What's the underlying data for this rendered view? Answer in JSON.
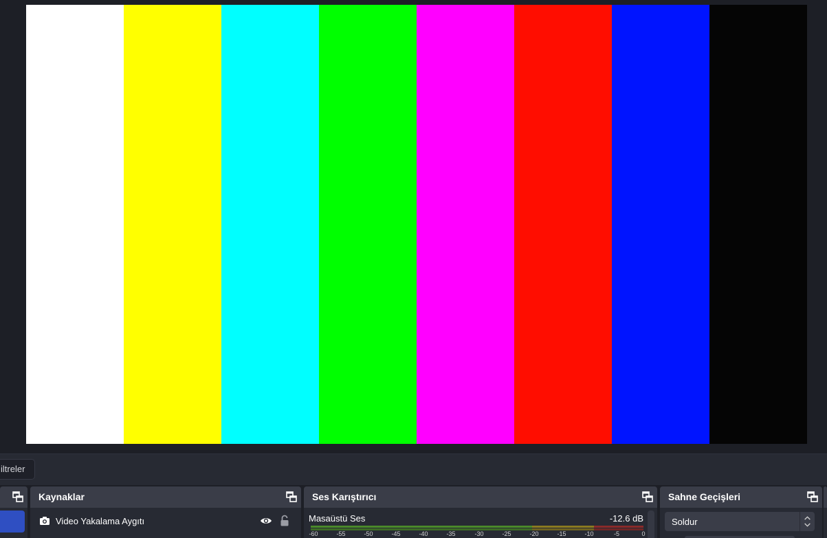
{
  "preview": {
    "color_bars": [
      "#ffffff",
      "#ffff00",
      "#00ffff",
      "#00ff00",
      "#ff00ff",
      "#ff0d00",
      "#0014ff",
      "#050505"
    ]
  },
  "toolbar": {
    "filters_label": "iltreler"
  },
  "docks": {
    "sources": {
      "title": "Kaynaklar",
      "items": [
        {
          "label": "Video Yakalama Aygıtı",
          "icon": "camera-icon"
        }
      ]
    },
    "mixer": {
      "title": "Ses Karıştırıcı",
      "channel": {
        "name": "Masaüstü Ses",
        "level": "-12.6 dB"
      },
      "scale_labels": [
        "-60",
        "-55",
        "-50",
        "-45",
        "-40",
        "-35",
        "-30",
        "-25",
        "-20",
        "-15",
        "-10",
        "-5",
        "0"
      ]
    },
    "transitions": {
      "title": "Sahne Geçişleri",
      "selected": "Soldur"
    }
  },
  "colors": {
    "accent": "#2f4fc2",
    "meter_green": "#4a8a2a",
    "meter_yellow": "#8a7a20",
    "meter_red": "#8a2a2a"
  }
}
